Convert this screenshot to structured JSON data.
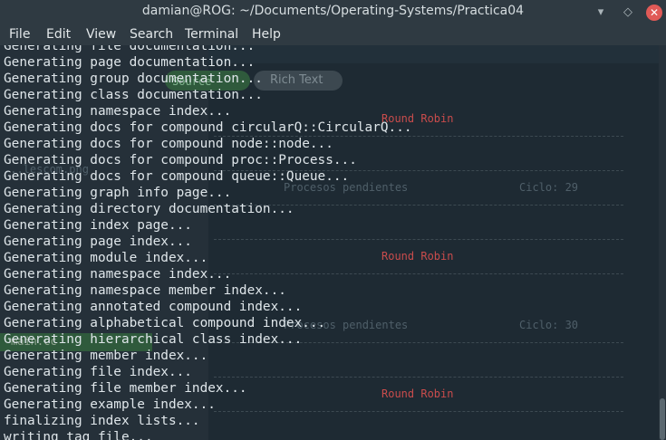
{
  "window": {
    "title": "damian@ROG: ~/Documents/Operating-Systems/Practica04",
    "minimize_glyph": "▾",
    "maximize_glyph": "◇",
    "close_glyph": "✕"
  },
  "menu": {
    "file": "File",
    "edit": "Edit",
    "view": "View",
    "search": "Search",
    "terminal": "Terminal",
    "help": "Help"
  },
  "terminal_lines": [
    "Generating file documentation...",
    "Generating page documentation...",
    "Generating group documentation...",
    "Generating class documentation...",
    "Generating namespace index...",
    "Generating docs for compound circularQ::CircularQ...",
    "Generating docs for compound node::node...",
    "Generating docs for compound proc::Process...",
    "Generating docs for compound queue::Queue...",
    "Generating graph info page...",
    "Generating directory documentation...",
    "Generating index page...",
    "Generating page index...",
    "Generating module index...",
    "Generating namespace index...",
    "Generating namespace member index...",
    "Generating annotated compound index...",
    "Generating alphabetical compound index...",
    "Generating hierarchical class index...",
    "Generating member index...",
    "Generating file index...",
    "Generating file member index...",
    "Generating example index...",
    "finalizing index lists...",
    "writing tag file..."
  ],
  "background_app": {
    "source_label": "Source",
    "rich_text_label": "Rich Text",
    "round_robin_1": "Round Robin",
    "round_robin_2": "Round Robin",
    "round_robin_3": "Round Robin",
    "procesos_1": "Procesos pendientes",
    "ciclo_1": "Ciclo: 29",
    "procesos_2": "Procesos pendientes",
    "ciclo_2": "Ciclo: 30",
    "file_1": "...lescom.png",
    "file_2": "main.cc"
  }
}
